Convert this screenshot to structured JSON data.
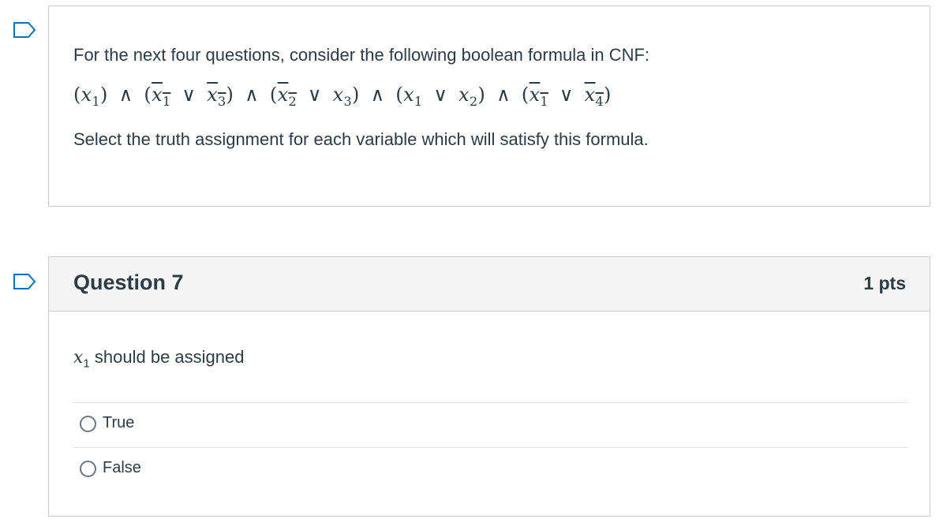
{
  "intro": {
    "line1": "For the next four questions, consider the following boolean formula in CNF:",
    "line3": "Select the truth assignment for each variable which will satisfy this formula."
  },
  "formula": {
    "lp": "(",
    "rp": ")",
    "and": "∧",
    "or": "∨",
    "var": "x",
    "s1": "1",
    "s2": "2",
    "s3": "3",
    "s4": "4"
  },
  "question": {
    "title": "Question 7",
    "points": "1 pts",
    "prompt_var": "x",
    "prompt_sub": "1",
    "prompt_text": "should be assigned",
    "options": [
      {
        "label": "True"
      },
      {
        "label": "False"
      }
    ]
  },
  "colors": {
    "text": "#2d3b45",
    "border": "#c7cdd1",
    "header_bg": "#f5f5f5",
    "flag": "#0374b5"
  },
  "icons": {
    "flag": "bookmark-flag-icon",
    "radio": "radio-button-icon"
  }
}
